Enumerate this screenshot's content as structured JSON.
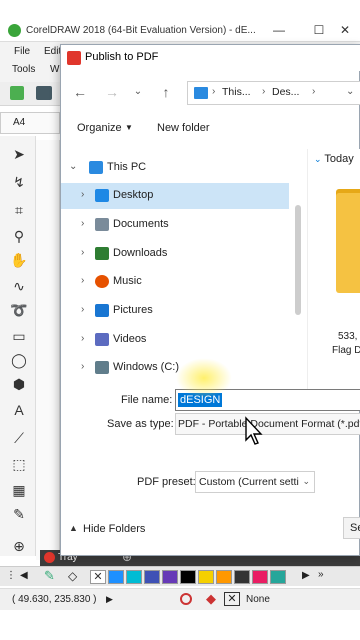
{
  "coreldraw": {
    "title": "CorelDRAW 2018 (64-Bit Evaluation Version) - dE...",
    "menu": [
      "File",
      "Edit",
      "Tools",
      "W"
    ],
    "font_size": "A4",
    "tray_label": "Tray",
    "status_coords": "( 49.630, 235.830 )",
    "status_fill": "None",
    "palette_colors": [
      "#ffffff",
      "#1e90ff",
      "#00bcd4",
      "#3f51b5",
      "#673ab7",
      "#000000",
      "#333333",
      "#f5d000",
      "#ff9800",
      "#e91e63",
      "#26a69a"
    ]
  },
  "dialog": {
    "title": "Publish to PDF",
    "breadcrumb": [
      "This...",
      "Des..."
    ],
    "organize_label": "Organize",
    "new_folder_label": "New folder",
    "tree": [
      {
        "label": "This PC",
        "selected": false,
        "icon_color": "#2a8ae0"
      },
      {
        "label": "Desktop",
        "selected": true,
        "icon_color": "#1e88e5"
      },
      {
        "label": "Documents",
        "selected": false,
        "icon_color": "#7a8b9a"
      },
      {
        "label": "Downloads",
        "selected": false,
        "icon_color": "#2e7d32"
      },
      {
        "label": "Music",
        "selected": false,
        "icon_color": "#e65100"
      },
      {
        "label": "Pictures",
        "selected": false,
        "icon_color": "#1976d2"
      },
      {
        "label": "Videos",
        "selected": false,
        "icon_color": "#5c6bc0"
      },
      {
        "label": "Windows (C:)",
        "selected": false,
        "icon_color": "#607d8b"
      }
    ],
    "content_header": "Today",
    "content_meta1": "533,",
    "content_meta2": "Flag D",
    "file_name_label": "File name:",
    "file_name_value": "dESIGN",
    "save_type_label": "Save as type:",
    "save_type_value": "PDF - Portable Document Format (*.pdf)",
    "pdf_preset_label": "PDF preset:",
    "pdf_preset_value": "Custom (Current setti",
    "hide_folders_label": "Hide Folders",
    "save_label": "Se"
  }
}
